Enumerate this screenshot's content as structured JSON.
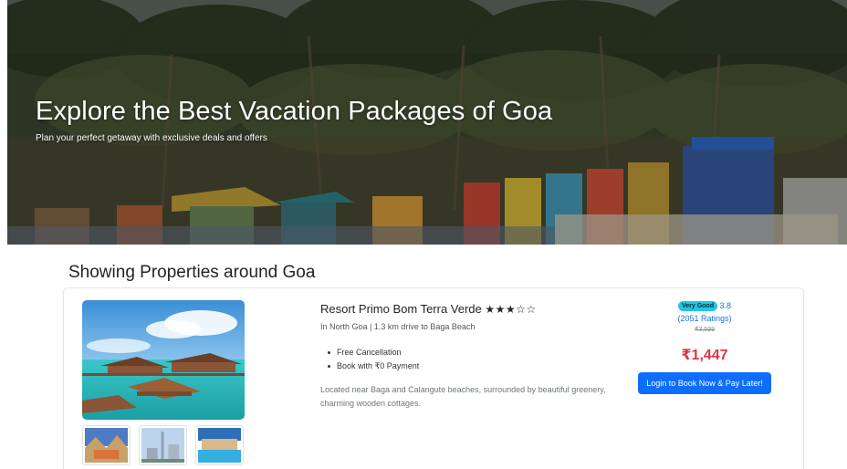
{
  "hero": {
    "title": "Explore the Best Vacation Packages of Goa",
    "subtitle": "Plan your perfect getaway with exclusive deals and offers"
  },
  "section": {
    "title": "Showing Properties around Goa"
  },
  "property": {
    "name": "Resort Primo Bom Terra Verde",
    "stars": "★★★☆☆",
    "location": "In North Goa | 1.3 km drive to Baga Beach",
    "features": [
      "Free Cancellation",
      "Book with ₹0 Payment"
    ],
    "description": "Located near Baga and Calangute beaches, surrounded by beautiful greenery, charming wooden cottages.",
    "rating_badge": "Very Good",
    "rating_value": "3.8",
    "ratings_count": "(2051 Ratings)",
    "original_price": "₹3,599",
    "price": "₹1,447",
    "book_button": "Login to Book Now & Pay Later!"
  },
  "colors": {
    "badge": "#1fc8e3",
    "price": "#dc3545",
    "button": "#0d6efd",
    "link": "#1a73e8"
  }
}
